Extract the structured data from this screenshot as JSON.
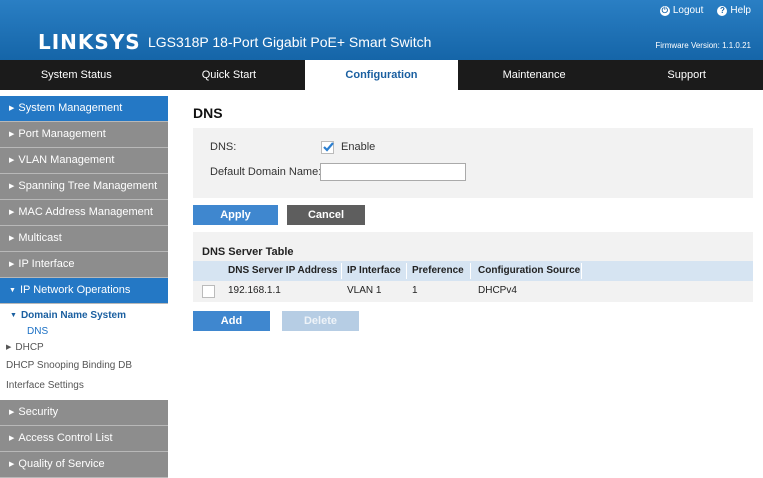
{
  "header": {
    "logo": "LINKSYS",
    "model": "LGS318P 18-Port Gigabit PoE+ Smart Switch",
    "logout": "Logout",
    "help": "Help",
    "firmware": "Firmware Version: 1.1.0.21"
  },
  "nav": {
    "tabs": [
      "System Status",
      "Quick Start",
      "Configuration",
      "Maintenance",
      "Support"
    ],
    "active": "Configuration"
  },
  "sidebar": {
    "top_items": [
      "System Management",
      "Port Management",
      "VLAN Management",
      "Spanning Tree Management",
      "MAC Address Management",
      "Multicast",
      "IP Interface",
      "IP Network Operations"
    ],
    "sub": {
      "domain_name_system": "Domain Name System",
      "dns": "DNS",
      "dhcp": "DHCP",
      "dhcp_snooping": "DHCP Snooping Binding DB",
      "interface_settings": "Interface Settings"
    },
    "bottom_items": [
      "Security",
      "Access Control List",
      "Quality of Service"
    ]
  },
  "main": {
    "title": "DNS",
    "dns_label": "DNS:",
    "enable_label": "Enable",
    "enable_checked": true,
    "domain_label": "Default Domain Name:",
    "domain_value": "",
    "apply": "Apply",
    "cancel": "Cancel",
    "table_title": "DNS Server Table",
    "columns": [
      "DNS Server IP Address",
      "IP Interface",
      "Preference",
      "Configuration Source"
    ],
    "rows": [
      {
        "ip": "192.168.1.1",
        "iface": "VLAN 1",
        "pref": "1",
        "source": "DHCPv4"
      }
    ],
    "add": "Add",
    "delete": "Delete"
  }
}
